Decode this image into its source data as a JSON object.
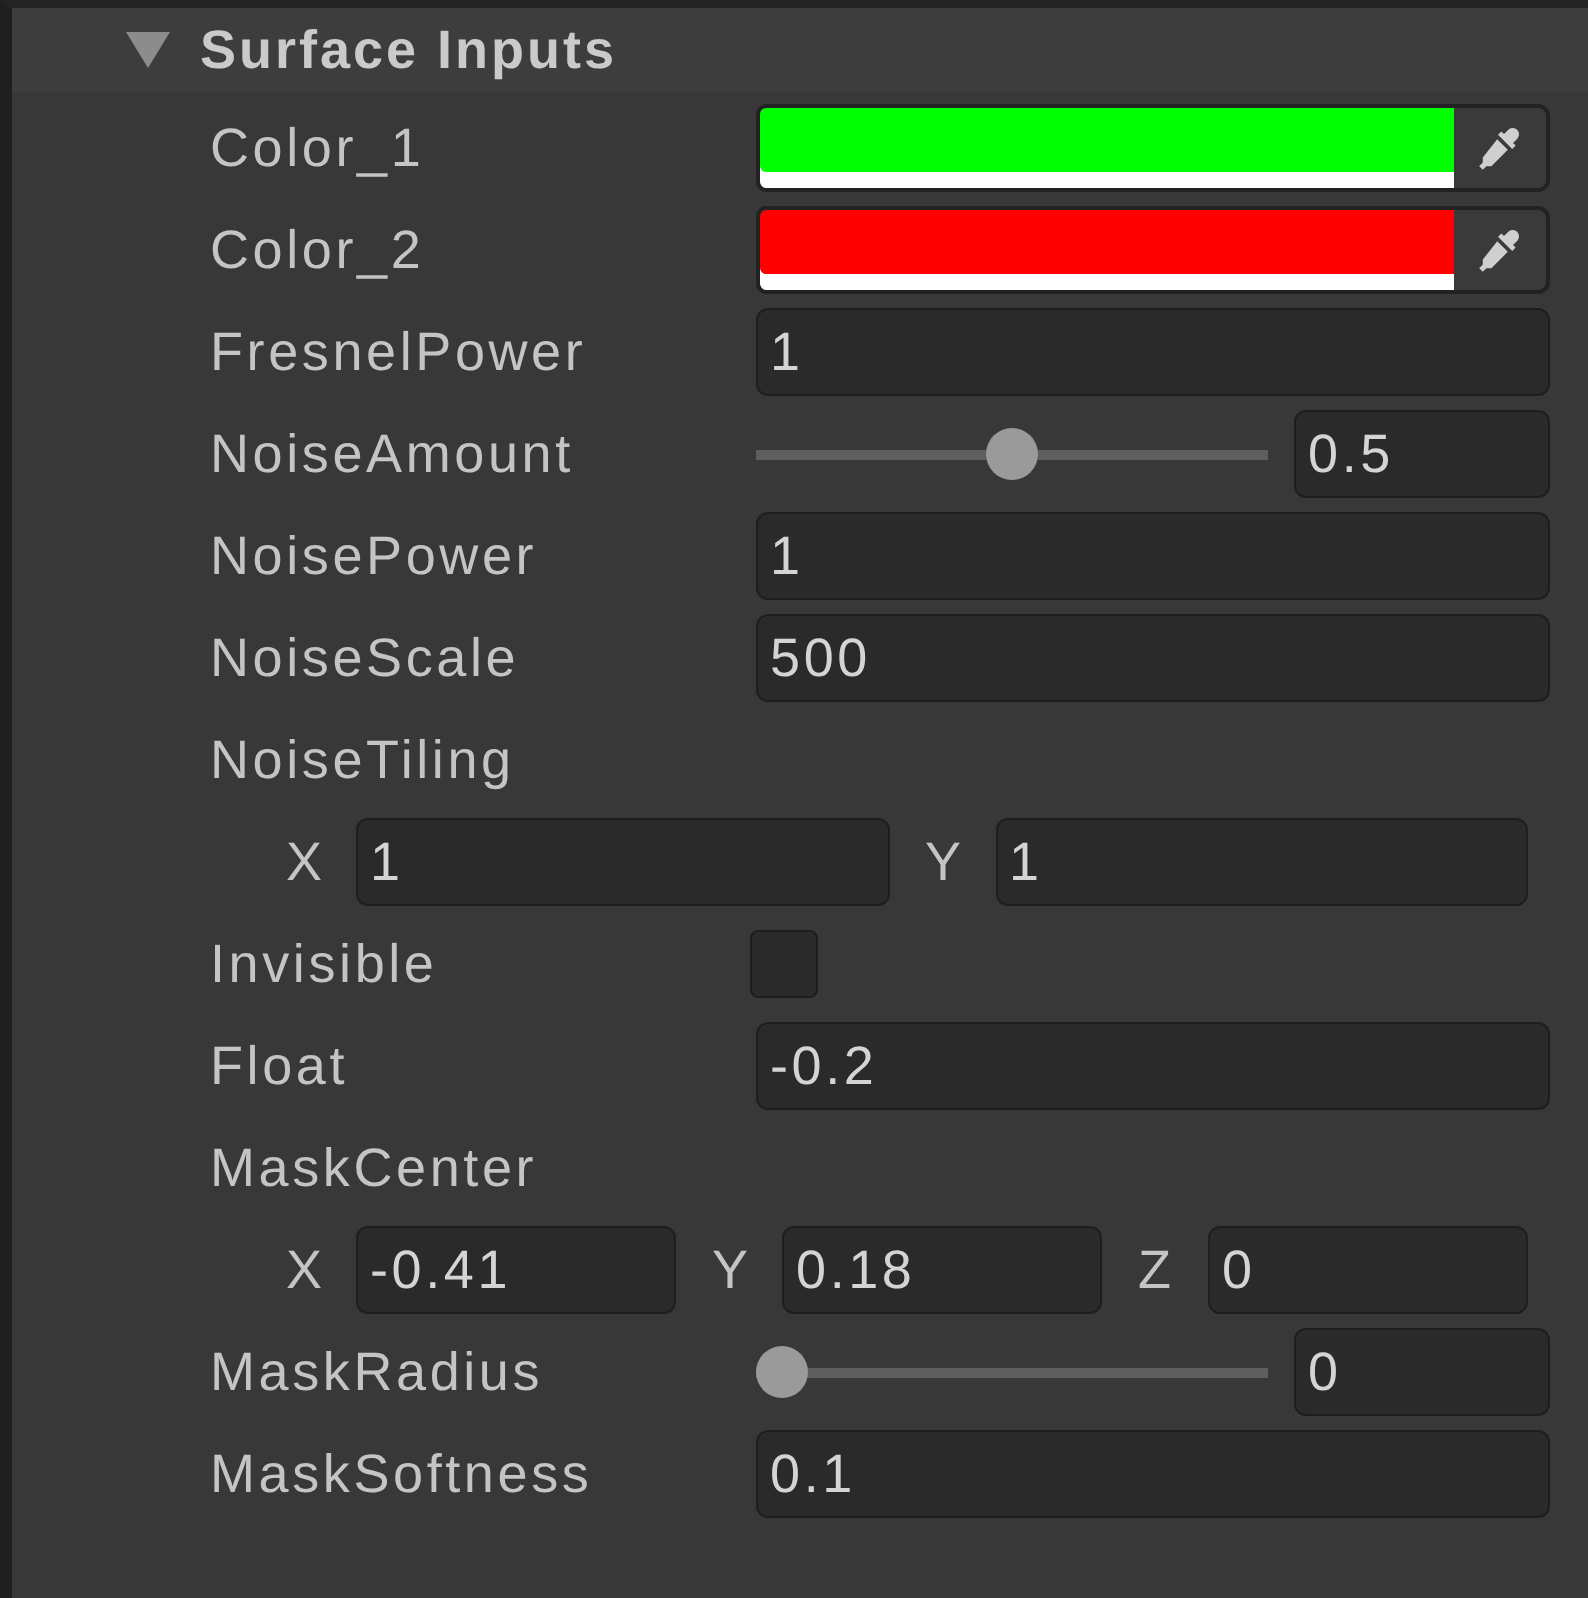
{
  "section": {
    "title": "Surface Inputs",
    "expanded": true
  },
  "properties": [
    {
      "kind": "color",
      "label": "Color_1",
      "color": "#00ff00"
    },
    {
      "kind": "color",
      "label": "Color_2",
      "color": "#ff0000"
    },
    {
      "kind": "float",
      "label": "FresnelPower",
      "value": "1"
    },
    {
      "kind": "slider",
      "label": "NoiseAmount",
      "level": 0.5,
      "value": "0.5"
    },
    {
      "kind": "float",
      "label": "NoisePower",
      "value": "1"
    },
    {
      "kind": "float",
      "label": "NoiseScale",
      "value": "500"
    },
    {
      "kind": "vector",
      "label": "NoiseTiling",
      "components": [
        {
          "axis": "X",
          "value": "1"
        },
        {
          "axis": "Y",
          "value": "1"
        }
      ]
    },
    {
      "kind": "toggle",
      "label": "Invisible",
      "checked": false
    },
    {
      "kind": "float",
      "label": "Float",
      "value": "-0.2"
    },
    {
      "kind": "vector",
      "label": "MaskCenter",
      "components": [
        {
          "axis": "X",
          "value": "-0.41"
        },
        {
          "axis": "Y",
          "value": "0.18"
        },
        {
          "axis": "Z",
          "value": "0"
        }
      ]
    },
    {
      "kind": "slider",
      "label": "MaskRadius",
      "level": 0,
      "value": "0"
    },
    {
      "kind": "float",
      "label": "MaskSoftness",
      "value": "0.1"
    }
  ]
}
